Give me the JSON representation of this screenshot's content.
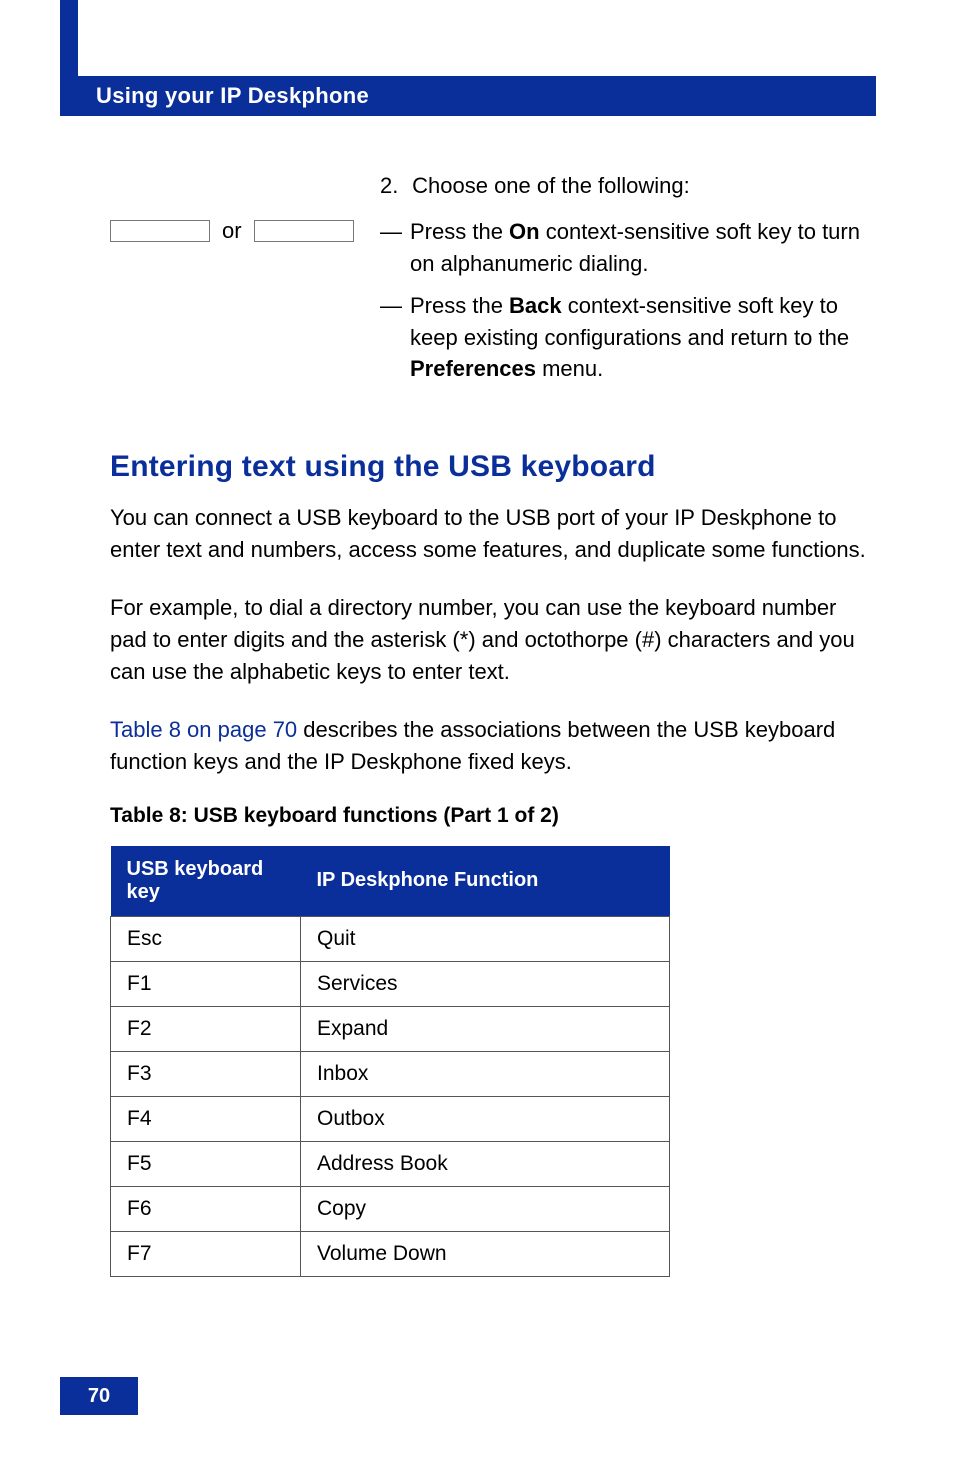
{
  "header": {
    "title": "Using your IP Deskphone"
  },
  "step": {
    "number": "2.",
    "or_label": "or",
    "instruction": "Choose one of the following:",
    "items": [
      {
        "dash": "—",
        "prefix": "Press the ",
        "keyname": "On",
        "tail1": " context-sensitive soft key to turn on alphanumeric dialing."
      },
      {
        "dash": "—",
        "prefix": "Press the ",
        "keyname": "Back",
        "tail1": " context-sensitive soft key to keep existing configurations and return to the ",
        "menuname": "Preferences",
        "tail2": " menu."
      }
    ]
  },
  "section": {
    "heading": "Entering text using the USB keyboard",
    "p1": "You can connect a USB keyboard to the USB port of your IP Deskphone to enter text and numbers, access some features, and duplicate some functions.",
    "p2": "For example, to dial a directory number, you can use the keyboard number pad to enter digits and the asterisk (*) and octothorpe (#) characters and you can use the alphabetic keys to enter text.",
    "p3_link": "Table 8 on page 70",
    "p3_rest": " describes the associations between the USB keyboard function keys and the IP Deskphone fixed keys."
  },
  "table": {
    "title": "Table 8: USB keyboard functions (Part 1 of 2)",
    "col1": "USB keyboard key",
    "col2": "IP Deskphone Function",
    "rows": [
      {
        "k": "Esc",
        "v": "Quit"
      },
      {
        "k": "F1",
        "v": "Services"
      },
      {
        "k": "F2",
        "v": "Expand"
      },
      {
        "k": "F3",
        "v": "Inbox"
      },
      {
        "k": "F4",
        "v": "Outbox"
      },
      {
        "k": "F5",
        "v": "Address Book"
      },
      {
        "k": "F6",
        "v": "Copy"
      },
      {
        "k": "F7",
        "v": "Volume Down"
      }
    ]
  },
  "footer": {
    "page": "70"
  }
}
